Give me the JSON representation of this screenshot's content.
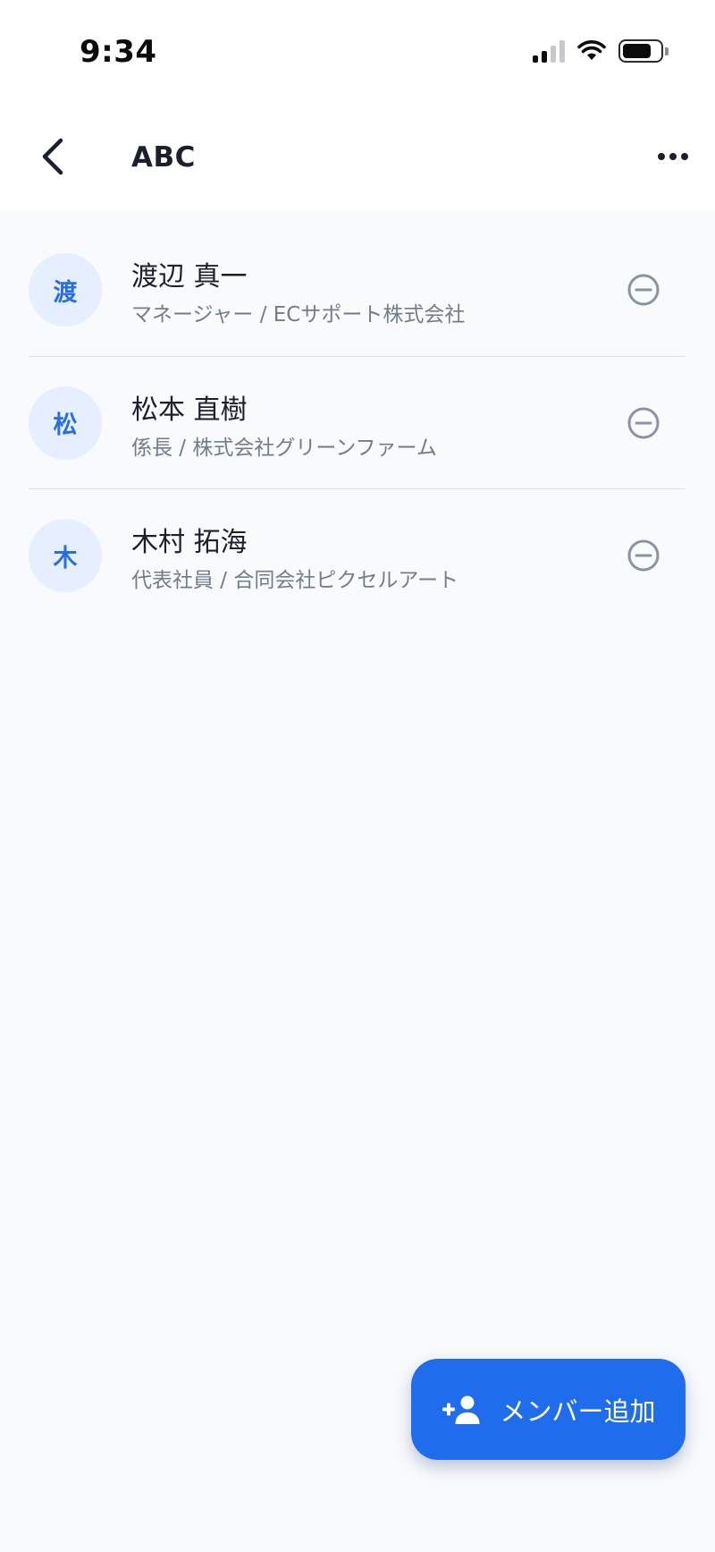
{
  "status_bar": {
    "time": "9:34"
  },
  "header": {
    "title": "ABC"
  },
  "members": [
    {
      "initial": "渡",
      "name": "渡辺 真一",
      "subtitle": "マネージャー / ECサポート株式会社"
    },
    {
      "initial": "松",
      "name": "松本 直樹",
      "subtitle": "係長 / 株式会社グリーンファーム"
    },
    {
      "initial": "木",
      "name": "木村 拓海",
      "subtitle": "代表社員 / 合同会社ピクセルアート"
    }
  ],
  "add_member": {
    "label": "メンバー追加"
  },
  "icons": {
    "back": "chevron-left-icon",
    "more": "more-horizontal-icon",
    "remove": "minus-circle-icon",
    "add_user": "person-add-icon"
  },
  "colors": {
    "accent": "#1f6ded",
    "avatar_bg": "#e6efff",
    "avatar_text": "#2b6ee0",
    "background": "#f8fafc",
    "subtitle": "#737c8c",
    "remove_icon": "#8a93a3"
  }
}
